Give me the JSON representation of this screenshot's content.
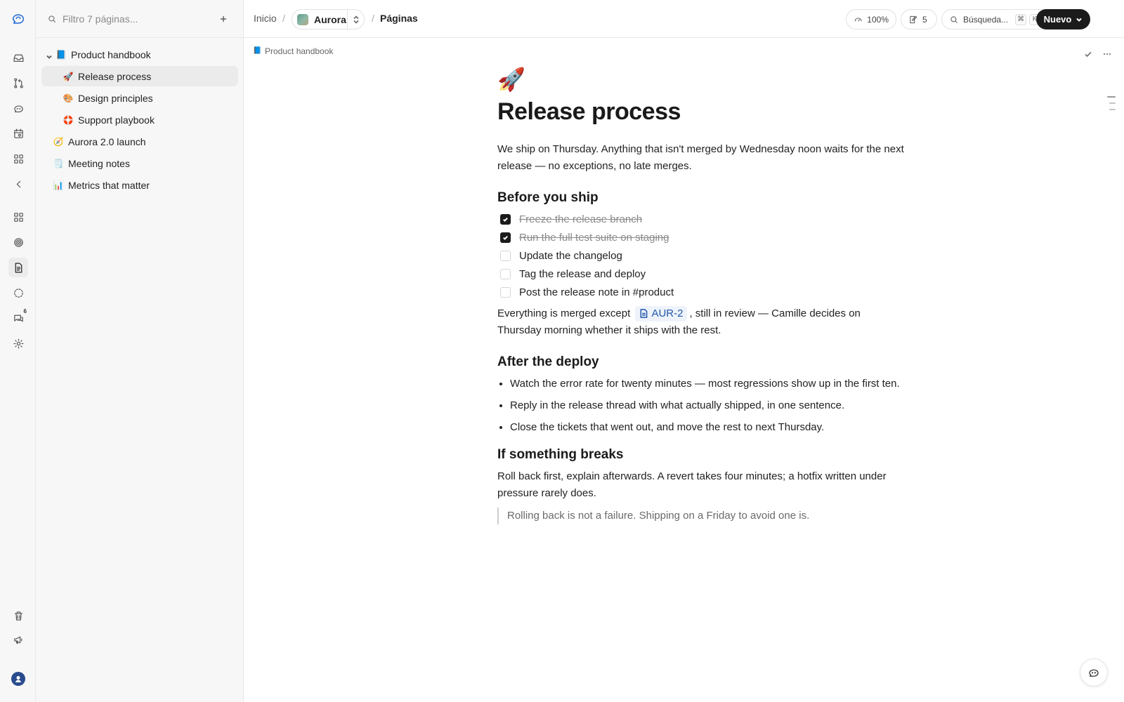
{
  "sidebar": {
    "filter_placeholder": "Filtro 7 páginas...",
    "items": [
      {
        "label": "Product handbook",
        "emoji": "📘"
      },
      {
        "label": "Release process",
        "emoji": "🚀"
      },
      {
        "label": "Design principles",
        "emoji": "🎨"
      },
      {
        "label": "Support playbook",
        "emoji": "🛟"
      },
      {
        "label": "Aurora 2.0 launch",
        "emoji": "🧭"
      },
      {
        "label": "Meeting notes",
        "emoji": "🗒️"
      },
      {
        "label": "Metrics that matter",
        "emoji": "📊"
      }
    ]
  },
  "rail": {
    "messages_badge": "6"
  },
  "topbar": {
    "crumb_home": "Inicio",
    "crumb_sep": "/",
    "project_name": "Aurora",
    "crumb_pages": "Páginas",
    "zoom": "100%",
    "drafts_count": "5",
    "search_label": "Búsqueda...",
    "search_kbd_1": "⌘",
    "search_kbd_2": "K",
    "new_label": "Nuevo"
  },
  "page": {
    "parent_crumb": "Product handbook",
    "parent_emoji": "📘",
    "emoji": "🚀",
    "title": "Release process",
    "intro": "We ship on Thursday. Anything that isn't merged by Wednesday noon waits for the next release — no exceptions, no late merges.",
    "h_before": "Before you ship",
    "todos": [
      {
        "text": "Freeze the release branch",
        "done": true
      },
      {
        "text": "Run the full test suite on staging",
        "done": true
      },
      {
        "text": "Update the changelog",
        "done": false
      },
      {
        "text": "Tag the release and deploy",
        "done": false
      },
      {
        "text": "Post the release note in #product",
        "done": false
      }
    ],
    "merged_pre": "Everything is merged except",
    "merged_chip": "AUR-2",
    "merged_post": ", still in review — Camille decides on Thursday morning whether it ships with the rest.",
    "h_after": "After the deploy",
    "bullets": [
      "Watch the error rate for twenty minutes — most regressions show up in the first ten.",
      "Reply in the release thread with what actually shipped, in one sentence.",
      "Close the tickets that went out, and move the rest to next Thursday."
    ],
    "h_breaks": "If something breaks",
    "breaks_para": "Roll back first, explain afterwards. A revert takes four minutes; a hotfix written under pressure rarely does.",
    "quote": "Rolling back is not a failure. Shipping on a Friday to avoid one is."
  }
}
